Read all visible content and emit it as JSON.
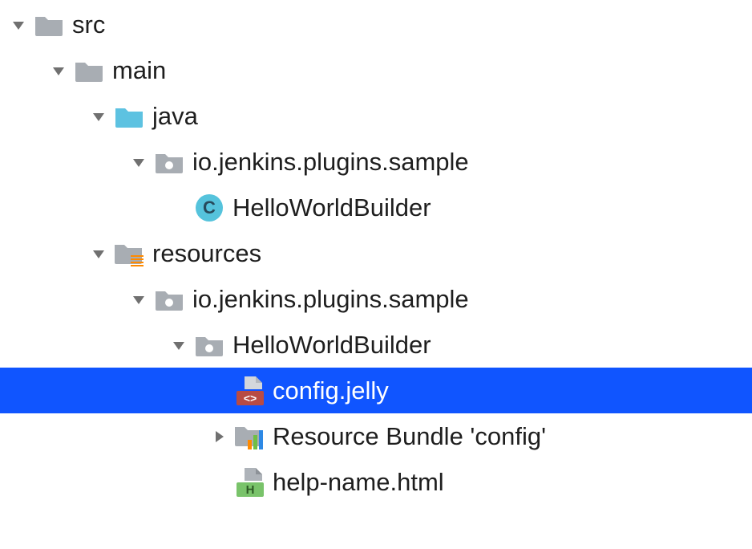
{
  "tree": {
    "nodes": [
      {
        "depth": 0,
        "expanded": true,
        "hasArrow": true,
        "icon": "folder-gray",
        "label": "src",
        "selected": false
      },
      {
        "depth": 1,
        "expanded": true,
        "hasArrow": true,
        "icon": "folder-gray",
        "label": "main",
        "selected": false
      },
      {
        "depth": 2,
        "expanded": true,
        "hasArrow": true,
        "icon": "folder-blue",
        "label": "java",
        "selected": false
      },
      {
        "depth": 3,
        "expanded": true,
        "hasArrow": true,
        "icon": "package",
        "label": "io.jenkins.plugins.sample",
        "selected": false
      },
      {
        "depth": 4,
        "expanded": false,
        "hasArrow": false,
        "icon": "class",
        "label": "HelloWorldBuilder",
        "selected": false
      },
      {
        "depth": 2,
        "expanded": true,
        "hasArrow": true,
        "icon": "resources",
        "label": "resources",
        "selected": false
      },
      {
        "depth": 3,
        "expanded": true,
        "hasArrow": true,
        "icon": "package",
        "label": "io.jenkins.plugins.sample",
        "selected": false
      },
      {
        "depth": 4,
        "expanded": true,
        "hasArrow": true,
        "icon": "package",
        "label": "HelloWorldBuilder",
        "selected": false
      },
      {
        "depth": 5,
        "expanded": false,
        "hasArrow": false,
        "icon": "jelly",
        "label": "config.jelly",
        "selected": true
      },
      {
        "depth": 5,
        "expanded": false,
        "hasArrow": true,
        "icon": "resource-bundle",
        "label": "Resource Bundle 'config'",
        "selected": false
      },
      {
        "depth": 5,
        "expanded": false,
        "hasArrow": false,
        "icon": "html",
        "label": "help-name.html",
        "selected": false
      }
    ]
  },
  "layout": {
    "indentUnit": 50,
    "baseIndent": 6
  }
}
